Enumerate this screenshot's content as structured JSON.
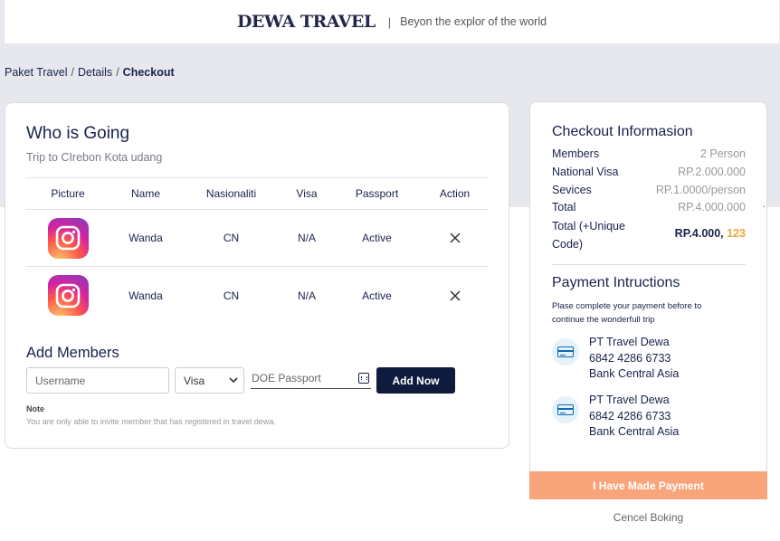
{
  "header": {
    "logo": "DEWA TRAVEL",
    "separator": "|",
    "tagline": "Beyon the explor of the world"
  },
  "breadcrumb": {
    "items": [
      "Paket Travel",
      "Details",
      "Checkout"
    ],
    "separator": "/"
  },
  "who_is_going": {
    "title": "Who is Going",
    "subtitle": "Trip to CIrebon Kota udang",
    "columns": [
      "Picture",
      "Name",
      "Nasionaliti",
      "Visa",
      "Passport",
      "Action"
    ],
    "rows": [
      {
        "name": "Wanda",
        "nationality": "CN",
        "visa": "N/A",
        "passport": "Active",
        "action_icon": "close-icon"
      },
      {
        "name": "Wanda",
        "nationality": "CN",
        "visa": "N/A",
        "passport": "Active",
        "action_icon": "close-icon"
      }
    ],
    "picture_icon": "instagram-icon"
  },
  "add_members": {
    "title": "Add Members",
    "username_placeholder": "Username",
    "visa_selected": "Visa",
    "doe_placeholder": "DOE Passport",
    "button_label": "Add Now",
    "note_title": "Note",
    "note_text": "You are only able to invite member that has registered in travel dewa."
  },
  "checkout_info": {
    "title": "Checkout Informasion",
    "rows": [
      {
        "label": "Members",
        "value": "2 Person"
      },
      {
        "label": "National Visa",
        "value": "RP.2.000.000"
      },
      {
        "label": "Sevices",
        "value": "RP.1.0000/person"
      },
      {
        "label": "Total",
        "value": "RP.4.000.000"
      }
    ],
    "total_unique_label": "Total (+Unique Code)",
    "total_unique_amount": "RP.4.000,",
    "total_unique_code": "123"
  },
  "payment": {
    "title": "Payment Intructions",
    "text": "Plase complete your payment before to continue the wonderfull trip",
    "banks": [
      {
        "name": "PT Travel Dewa",
        "account": "6842 4286 6733",
        "bank": "Bank Central Asia"
      },
      {
        "name": "PT Travel Dewa",
        "account": "6842 4286 6733",
        "bank": "Bank Central Asia"
      }
    ],
    "bank_icon": "credit-card-icon",
    "paid_button": "I Have Made Payment",
    "cancel_link": "Cencel Boking"
  },
  "colors": {
    "navy": "#18224b",
    "button_dark": "#0e1b3d",
    "accent_orange": "#f8a57c",
    "unique_code": "#f0a63a",
    "band": "#e7e8ed"
  }
}
